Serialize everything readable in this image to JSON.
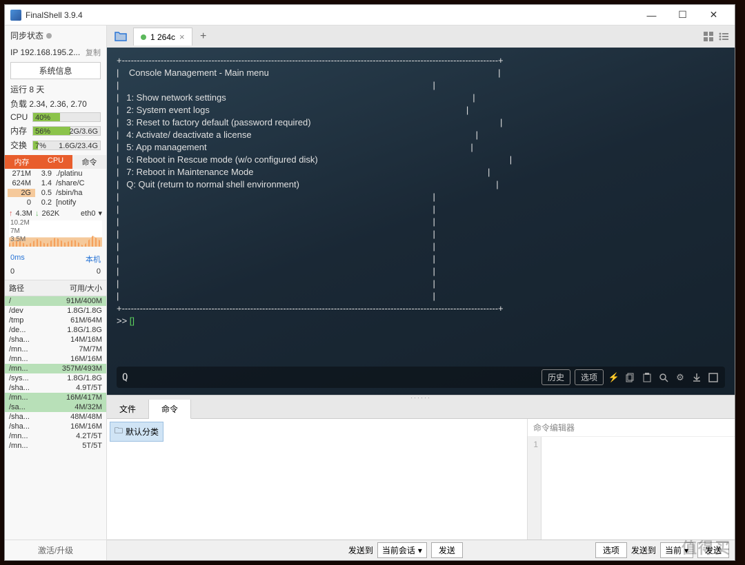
{
  "titlebar": {
    "title": "FinalShell 3.9.4"
  },
  "sidebar": {
    "sync_label": "同步状态",
    "ip": "IP 192.168.195.2...",
    "copy": "复制",
    "sysinfo_btn": "系统信息",
    "uptime": "运行 8 天",
    "load": "负载 2.34, 2.36, 2.70",
    "cpu": {
      "label": "CPU",
      "pct": "40%",
      "width": 40
    },
    "mem": {
      "label": "内存",
      "pct": "56%",
      "right": "2G/3.6G",
      "width": 56
    },
    "swap": {
      "label": "交换",
      "pct": "7%",
      "right": "1.6G/23.4G",
      "width": 7
    },
    "proc_tabs": {
      "mem": "内存",
      "cpu": "CPU",
      "cmd": "命令"
    },
    "procs": [
      {
        "m": "271M",
        "c": "3.9",
        "n": "./platinu"
      },
      {
        "m": "624M",
        "c": "1.4",
        "n": "/share/C"
      },
      {
        "m": "2G",
        "c": "0.5",
        "n": "/sbin/ha"
      },
      {
        "m": "0",
        "c": "0.2",
        "n": "[notify"
      }
    ],
    "net": {
      "up": "4.3M",
      "down": "262K",
      "iface": "eth0"
    },
    "net_axis": [
      "10.2M",
      "7M",
      "3.5M"
    ],
    "ping": {
      "latency": "0ms",
      "host": "本机"
    },
    "ping_vals": {
      "a": "0",
      "b": "0"
    },
    "disk_hdr": {
      "path": "路径",
      "avail": "可用/大小"
    },
    "disks": [
      {
        "p": "/",
        "v": "91M/400M",
        "hl": true
      },
      {
        "p": "/dev",
        "v": "1.8G/1.8G"
      },
      {
        "p": "/tmp",
        "v": "61M/64M"
      },
      {
        "p": "/de...",
        "v": "1.8G/1.8G"
      },
      {
        "p": "/sha...",
        "v": "14M/16M"
      },
      {
        "p": "/mn...",
        "v": "7M/7M"
      },
      {
        "p": "/mn...",
        "v": "16M/16M"
      },
      {
        "p": "/mn...",
        "v": "357M/493M",
        "hl": true
      },
      {
        "p": "/sys...",
        "v": "1.8G/1.8G"
      },
      {
        "p": "/sha...",
        "v": "4.9T/5T"
      },
      {
        "p": "/mn...",
        "v": "16M/417M",
        "hl": true
      },
      {
        "p": "/sa...",
        "v": "4M/32M",
        "hl": true
      },
      {
        "p": "/sha...",
        "v": "48M/48M"
      },
      {
        "p": "/sha...",
        "v": "16M/16M"
      },
      {
        "p": "/mn...",
        "v": "4.2T/5T"
      },
      {
        "p": "/mn...",
        "v": "5T/5T"
      }
    ],
    "activate": "激活/升级"
  },
  "tabs": {
    "t1": "1 264c"
  },
  "terminal": {
    "box_top": "+------------------------------------------------------------------------------------------------------------------------------+",
    "title": "|    Console Management - Main menu                                                                                            |",
    "empty": "|                                                                                                                              |",
    "m1": "|   1: Show network settings                                                                                                   |",
    "m2": "|   2: System event logs                                                                                                       |",
    "m3": "|   3: Reset to factory default (password required)                                                                            |",
    "m4": "|   4: Activate/ deactivate a license                                                                                          |",
    "m5": "|   5: App management                                                                                                          |",
    "m6": "|   6: Reboot in Rescue mode (w/o configured disk)                                                                             |",
    "m7": "|   7: Reboot in Maintenance Mode                                                                                              |",
    "mq": "|   Q: Quit (return to normal shell environment)                                                                               |",
    "prompt": ">> ",
    "input_val": "Q"
  },
  "cmd_btns": {
    "history": "历史",
    "options": "选项"
  },
  "bottom": {
    "tab_file": "文件",
    "tab_cmd": "命令",
    "default_cat": "默认分类",
    "editor_title": "命令编辑器",
    "line1": "1"
  },
  "footer": {
    "send_to": "发送到",
    "current_session": "当前会话",
    "send": "发送",
    "options": "选项",
    "current": "当前"
  },
  "watermark": "值得买"
}
